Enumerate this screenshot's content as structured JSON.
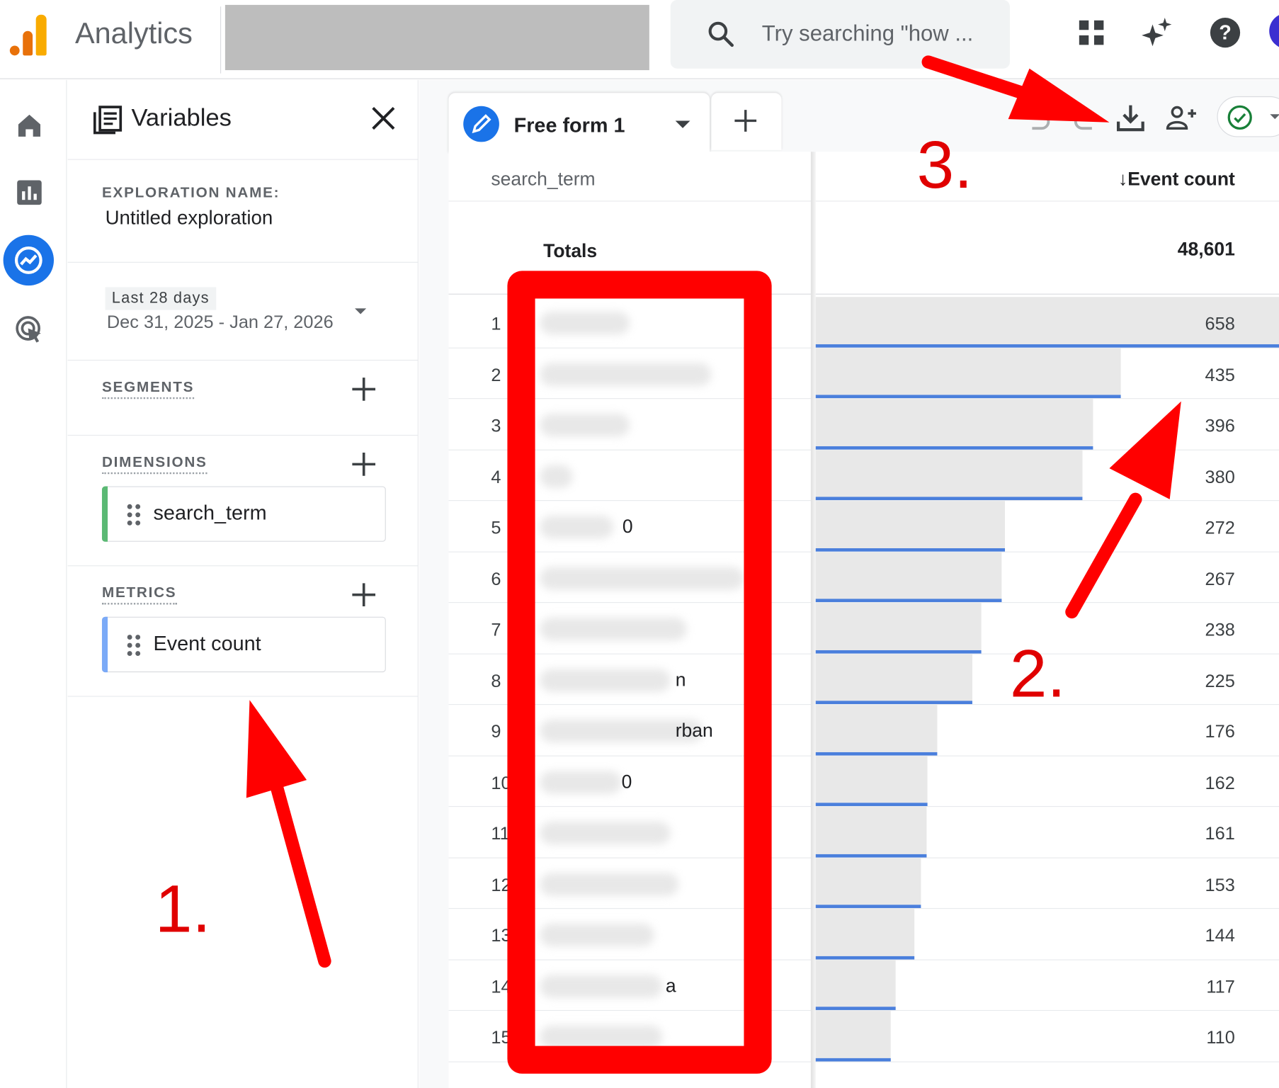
{
  "app": {
    "title": "Analytics",
    "search_placeholder": "Try searching \"how ...",
    "brand_colors": {
      "orange_dark": "#e8710a",
      "orange_light": "#f9ab00",
      "accent": "#1a73e8"
    }
  },
  "topbar": {
    "icons": [
      "apps-grid-icon",
      "sparkle-icon",
      "help-icon"
    ]
  },
  "rail": {
    "items": [
      "home-icon",
      "reports-icon",
      "explore-icon",
      "advertising-icon"
    ]
  },
  "variables_panel": {
    "title": "Variables",
    "exploration_name_label": "EXPLORATION NAME:",
    "exploration_name": "Untitled exploration",
    "date_chip": "Last 28 days",
    "date_range": "Dec 31, 2025 - Jan 27, 2026",
    "segments_label": "SEGMENTS",
    "dimensions_label": "DIMENSIONS",
    "dimension_item": "search_term",
    "metrics_label": "METRICS",
    "metric_item": "Event count"
  },
  "tabs": {
    "active_tab": "Free form 1"
  },
  "table": {
    "dimension_header": "search_term",
    "metric_header": "↓Event count",
    "totals_label": "Totals",
    "totals_value": "48,601",
    "rows": [
      {
        "idx": "1",
        "tail": "",
        "value": "658",
        "share": 1.0
      },
      {
        "idx": "2",
        "tail": "",
        "value": "435",
        "share": 0.661
      },
      {
        "idx": "3",
        "tail": "",
        "value": "396",
        "share": 0.602
      },
      {
        "idx": "4",
        "tail": "",
        "value": "380",
        "share": 0.578
      },
      {
        "idx": "5",
        "tail": "0",
        "value": "272",
        "share": 0.413
      },
      {
        "idx": "6",
        "tail": "",
        "value": "267",
        "share": 0.406
      },
      {
        "idx": "7",
        "tail": "",
        "value": "238",
        "share": 0.362
      },
      {
        "idx": "8",
        "tail": "n",
        "value": "225",
        "share": 0.342
      },
      {
        "idx": "9",
        "tail": "rban",
        "value": "176",
        "share": 0.267
      },
      {
        "idx": "10",
        "tail": "0",
        "value": "162",
        "share": 0.246
      },
      {
        "idx": "11",
        "tail": "",
        "value": "161",
        "share": 0.245
      },
      {
        "idx": "12",
        "tail": "",
        "value": "153",
        "share": 0.233
      },
      {
        "idx": "13",
        "tail": "",
        "value": "144",
        "share": 0.219
      },
      {
        "idx": "14",
        "tail": "a",
        "value": "117",
        "share": 0.178
      },
      {
        "idx": "15",
        "tail": "",
        "value": "110",
        "share": 0.167
      }
    ]
  },
  "annotations": {
    "step1": "1.",
    "step2": "2.",
    "step3": "3.",
    "color": "#ff0000"
  }
}
